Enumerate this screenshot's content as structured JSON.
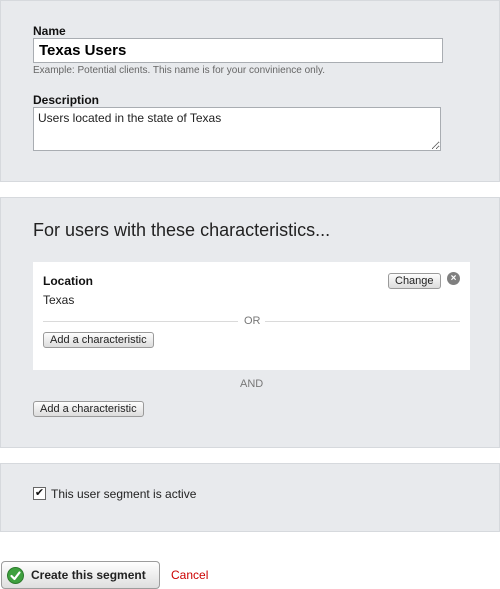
{
  "details": {
    "name_label": "Name",
    "name_value": "Texas Users",
    "name_hint": "Example: Potential clients. This name is for your convinience only.",
    "description_label": "Description",
    "description_value": "Users located in the state of Texas"
  },
  "characteristics": {
    "heading": "For users with these characteristics...",
    "groups": [
      {
        "name": "Location",
        "value": "Texas",
        "change_label": "Change",
        "or_label": "OR",
        "add_label": "Add a characteristic"
      }
    ],
    "and_label": "AND",
    "add_label": "Add a characteristic"
  },
  "status": {
    "active_checked": true,
    "active_label": "This user segment is active"
  },
  "actions": {
    "create_label": "Create this segment",
    "cancel_label": "Cancel"
  },
  "colors": {
    "panel_bg": "#e8eaed",
    "cancel": "#cc0000",
    "check_green": "#3ea03e"
  },
  "icons": {
    "remove": "close-icon",
    "submit": "check-circle-icon",
    "active": "checkbox-checked-icon"
  }
}
